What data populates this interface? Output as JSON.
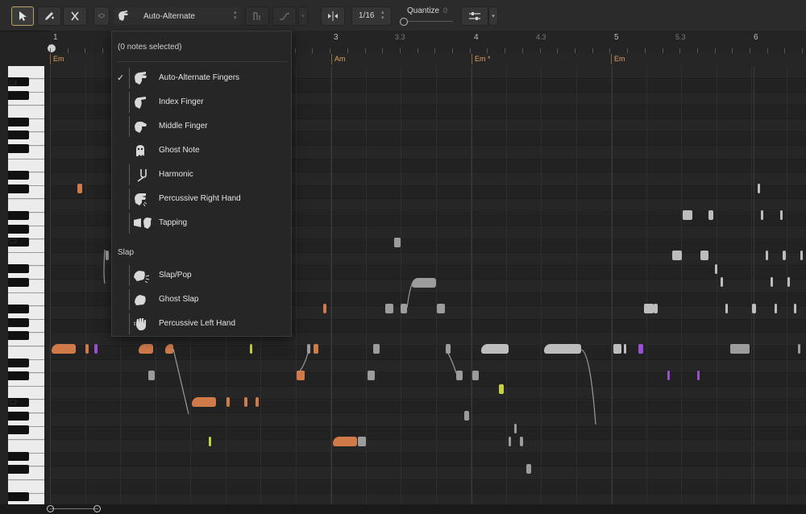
{
  "toolbar": {
    "technique_label": "Auto-Alternate",
    "quantize_label": "Quantize",
    "quantize_value": "0",
    "grid_value": "1/16"
  },
  "ruler": {
    "markers": [
      {
        "label": "1",
        "sub": false
      },
      {
        "label": "3",
        "sub": false
      },
      {
        "label": "3.3",
        "sub": true
      },
      {
        "label": "4",
        "sub": false
      },
      {
        "label": "4.3",
        "sub": true
      },
      {
        "label": "5",
        "sub": false
      },
      {
        "label": "5.3",
        "sub": true
      },
      {
        "label": "6",
        "sub": false
      }
    ]
  },
  "chords": [
    "Em",
    "Am",
    "Em *",
    "Em"
  ],
  "piano": {
    "labels": [
      "C4",
      "C3",
      "C2"
    ]
  },
  "dropdown": {
    "header": "(0 notes selected)",
    "items": [
      {
        "label": "Auto-Alternate Fingers",
        "icon": "auto-alternate-hand-icon",
        "checked": true
      },
      {
        "label": "Index Finger",
        "icon": "index-finger-icon",
        "checked": false
      },
      {
        "label": "Middle Finger",
        "icon": "middle-finger-icon",
        "checked": false
      },
      {
        "label": "Ghost Note",
        "icon": "ghost-icon",
        "checked": false
      },
      {
        "label": "Harmonic",
        "icon": "harmonic-tuning-fork-icon",
        "checked": false
      },
      {
        "label": "Percussive Right Hand",
        "icon": "percussive-right-hand-icon",
        "checked": false
      },
      {
        "label": "Tapping",
        "icon": "tapping-hands-icon",
        "checked": false
      }
    ],
    "section_label": "Slap",
    "slap_items": [
      {
        "label": "Slap/Pop",
        "icon": "slap-pop-icon"
      },
      {
        "label": "Ghost Slap",
        "icon": "ghost-slap-icon"
      },
      {
        "label": "Percussive Left Hand",
        "icon": "percussive-left-hand-icon"
      }
    ]
  },
  "colors": {
    "accent_active": "#b9a16a",
    "note_gray": "#9c9c9c",
    "note_orange": "#d07a4a",
    "note_purple": "#9a4fd0",
    "note_yellow": "#c9d040",
    "chord_text": "#e0a060"
  }
}
